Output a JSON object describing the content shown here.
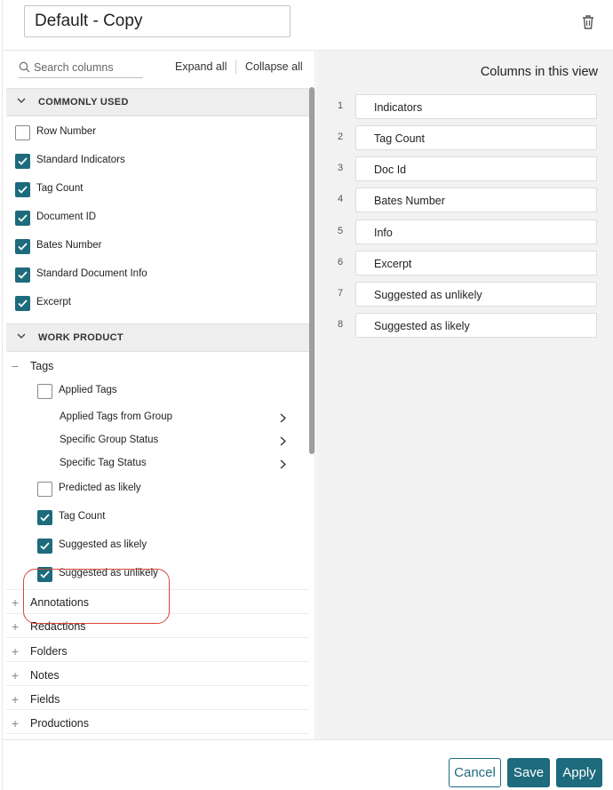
{
  "header": {
    "view_name": "Default - Copy",
    "delete_icon": "trash-icon"
  },
  "left_panel": {
    "search_placeholder": "Search columns",
    "expand_all": "Expand all",
    "collapse_all": "Collapse all",
    "sections": [
      {
        "title": "COMMONLY USED",
        "items": [
          {
            "label": "Row Number",
            "checked": false
          },
          {
            "label": "Standard Indicators",
            "checked": true
          },
          {
            "label": "Tag Count",
            "checked": true
          },
          {
            "label": "Document ID",
            "checked": true
          },
          {
            "label": "Bates Number",
            "checked": true
          },
          {
            "label": "Standard Document Info",
            "checked": true
          },
          {
            "label": "Excerpt",
            "checked": true
          }
        ]
      },
      {
        "title": "WORK PRODUCT",
        "groups": [
          {
            "label": "Tags",
            "expanded": true,
            "items": [
              {
                "label": "Applied Tags",
                "checked": false
              },
              {
                "label": "Applied Tags from Group",
                "submenu": true
              },
              {
                "label": "Specific Group Status",
                "submenu": true
              },
              {
                "label": "Specific Tag Status",
                "submenu": true
              },
              {
                "label": "Predicted as likely",
                "checked": false
              },
              {
                "label": "Tag Count",
                "checked": true
              },
              {
                "label": "Suggested as likely",
                "checked": true
              },
              {
                "label": "Suggested as unlikely",
                "checked": true
              }
            ]
          },
          {
            "label": "Annotations",
            "expanded": false
          },
          {
            "label": "Redactions",
            "expanded": false
          },
          {
            "label": "Folders",
            "expanded": false
          },
          {
            "label": "Notes",
            "expanded": false
          },
          {
            "label": "Fields",
            "expanded": false
          },
          {
            "label": "Productions",
            "expanded": false
          }
        ]
      }
    ]
  },
  "right_panel": {
    "title": "Columns in this view",
    "columns": [
      {
        "num": "1",
        "label": "Indicators"
      },
      {
        "num": "2",
        "label": "Tag Count"
      },
      {
        "num": "3",
        "label": "Doc Id"
      },
      {
        "num": "4",
        "label": "Bates Number"
      },
      {
        "num": "5",
        "label": "Info"
      },
      {
        "num": "6",
        "label": "Excerpt"
      },
      {
        "num": "7",
        "label": "Suggested as unlikely"
      },
      {
        "num": "8",
        "label": "Suggested as likely"
      }
    ]
  },
  "footer": {
    "cancel": "Cancel",
    "save": "Save",
    "apply": "Apply"
  },
  "colors": {
    "accent": "#1d6b7c",
    "highlight": "#d9453a"
  }
}
